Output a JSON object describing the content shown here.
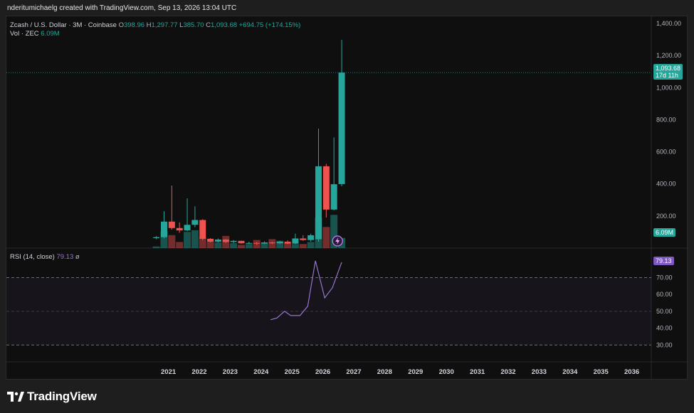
{
  "header": {
    "text": "nderitumichaelg created with TradingView.com, Sep 13, 2026 13:04 UTC"
  },
  "legend": {
    "symbol": "Zcash / U.S. Dollar · 3M · Coinbase",
    "o_label": "O",
    "o_value": "398.96",
    "h_label": "H",
    "h_value": "1,297.77",
    "l_label": "L",
    "l_value": "385.70",
    "c_label": "C",
    "c_value": "1,093.68",
    "change": "+694.75 (+174.15%)",
    "vol_label": "Vol · ZEC",
    "vol_value": "6.09M",
    "rsi_label": "RSI (14, close)",
    "rsi_value": "79.13",
    "rsi_extra": "ø"
  },
  "price_tag": {
    "value": "1,093.68",
    "countdown": "17d 11h"
  },
  "vol_tag": "6.09M",
  "rsi_tag": "79.13",
  "footer": {
    "brand": "TradingView"
  },
  "colors": {
    "up": "#26a69a",
    "down": "#ef5350",
    "rsi": "#9575cd",
    "bg": "#0f0f0f"
  },
  "chart_data": {
    "type": "candlestick",
    "price_axis": {
      "min": 0,
      "max": 1400,
      "ticks": [
        "200.00",
        "400.00",
        "600.00",
        "800.00",
        "1,000.00",
        "1,200.00",
        "1,400.00"
      ],
      "tick_values": [
        200,
        400,
        600,
        800,
        1000,
        1200,
        1400
      ]
    },
    "rsi_axis": {
      "min": 20,
      "max": 85,
      "ticks": [
        "30.00",
        "40.00",
        "50.00",
        "60.00",
        "70.00"
      ],
      "tick_values": [
        30,
        40,
        50,
        60,
        70
      ],
      "band": [
        30,
        70
      ]
    },
    "x_axis": {
      "labels": [
        "2021",
        "2022",
        "2023",
        "2024",
        "2025",
        "2026",
        "2027",
        "2028",
        "2029",
        "2030",
        "2031",
        "2032",
        "2033",
        "2034",
        "2035",
        "2036"
      ],
      "start_year": 2021
    },
    "candles": [
      {
        "t": 2020.6,
        "o": 62,
        "h": 75,
        "l": 55,
        "c": 68
      },
      {
        "t": 2020.85,
        "o": 68,
        "h": 230,
        "l": 60,
        "c": 165
      },
      {
        "t": 2021.1,
        "o": 165,
        "h": 390,
        "l": 115,
        "c": 125
      },
      {
        "t": 2021.35,
        "o": 125,
        "h": 160,
        "l": 95,
        "c": 110
      },
      {
        "t": 2021.6,
        "o": 110,
        "h": 310,
        "l": 105,
        "c": 145
      },
      {
        "t": 2021.85,
        "o": 145,
        "h": 260,
        "l": 130,
        "c": 175
      },
      {
        "t": 2022.1,
        "o": 175,
        "h": 180,
        "l": 50,
        "c": 58
      },
      {
        "t": 2022.35,
        "o": 58,
        "h": 62,
        "l": 35,
        "c": 40
      },
      {
        "t": 2022.6,
        "o": 40,
        "h": 60,
        "l": 35,
        "c": 53
      },
      {
        "t": 2022.85,
        "o": 53,
        "h": 56,
        "l": 32,
        "c": 38
      },
      {
        "t": 2023.1,
        "o": 38,
        "h": 50,
        "l": 30,
        "c": 45
      },
      {
        "t": 2023.35,
        "o": 45,
        "h": 46,
        "l": 27,
        "c": 30
      },
      {
        "t": 2023.6,
        "o": 30,
        "h": 40,
        "l": 26,
        "c": 32
      },
      {
        "t": 2023.85,
        "o": 32,
        "h": 38,
        "l": 20,
        "c": 28
      },
      {
        "t": 2024.1,
        "o": 28,
        "h": 42,
        "l": 25,
        "c": 35
      },
      {
        "t": 2024.35,
        "o": 35,
        "h": 40,
        "l": 25,
        "c": 30
      },
      {
        "t": 2024.6,
        "o": 30,
        "h": 45,
        "l": 25,
        "c": 40
      },
      {
        "t": 2024.85,
        "o": 40,
        "h": 48,
        "l": 25,
        "c": 28
      },
      {
        "t": 2025.1,
        "o": 28,
        "h": 90,
        "l": 25,
        "c": 60
      },
      {
        "t": 2025.35,
        "o": 60,
        "h": 80,
        "l": 45,
        "c": 50
      },
      {
        "t": 2025.6,
        "o": 50,
        "h": 90,
        "l": 40,
        "c": 80
      },
      {
        "t": 2025.85,
        "o": 55,
        "h": 745,
        "l": 40,
        "c": 510
      },
      {
        "t": 2026.1,
        "o": 510,
        "h": 525,
        "l": 190,
        "c": 240
      },
      {
        "t": 2026.35,
        "o": 240,
        "h": 690,
        "l": 235,
        "c": 398
      },
      {
        "t": 2026.6,
        "o": 398.96,
        "h": 1297.77,
        "l": 385.7,
        "c": 1093.68
      }
    ],
    "volume_scale_max": 1.0,
    "volume": [
      0.04,
      0.42,
      0.32,
      0.15,
      0.4,
      0.44,
      0.26,
      0.16,
      0.14,
      0.3,
      0.12,
      0.08,
      0.1,
      0.2,
      0.14,
      0.22,
      0.18,
      0.12,
      0.1,
      0.1,
      0.15,
      0.75,
      0.52,
      0.82,
      0.25
    ],
    "rsi": [
      {
        "t": 2024.3,
        "v": 45
      },
      {
        "t": 2024.5,
        "v": 46
      },
      {
        "t": 2024.75,
        "v": 50
      },
      {
        "t": 2024.95,
        "v": 47.5
      },
      {
        "t": 2025.25,
        "v": 47.5
      },
      {
        "t": 2025.5,
        "v": 53
      },
      {
        "t": 2025.75,
        "v": 80
      },
      {
        "t": 2026.05,
        "v": 58
      },
      {
        "t": 2026.3,
        "v": 64
      },
      {
        "t": 2026.6,
        "v": 79.13
      }
    ]
  }
}
